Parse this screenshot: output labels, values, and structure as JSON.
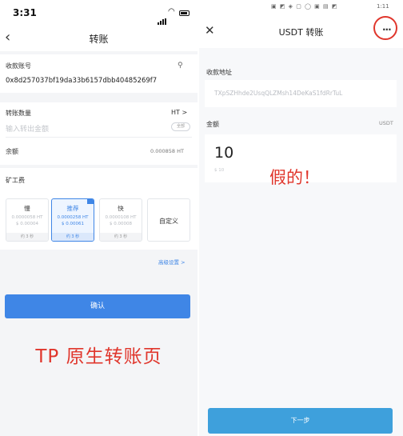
{
  "left": {
    "status": {
      "time": "3:31"
    },
    "nav": {
      "back_icon": "chevron-left-icon",
      "title": "转账"
    },
    "receiver": {
      "label": "收款账号",
      "address": "0x8d257037bf19da33b6157dbb40485269f7",
      "icon": "contact-add-icon"
    },
    "amount": {
      "label": "转账数量",
      "token": "HT >",
      "placeholder": "输入转出金额",
      "all_button": "全部"
    },
    "balance": {
      "label": "余额",
      "value": "0.000858 HT"
    },
    "fee": {
      "label": "矿工费",
      "options": [
        {
          "name": "慢",
          "line1": "0.0000058 HT",
          "line2": "$ 0.00004",
          "time": "约 3 秒",
          "selected": false
        },
        {
          "name": "推荐",
          "line1": "0.0000258 HT",
          "line2": "$ 0.00061",
          "time": "约 3 秒",
          "selected": true
        },
        {
          "name": "快",
          "line1": "0.0000108 HT",
          "line2": "$ 0.00008",
          "time": "约 3 秒",
          "selected": false
        },
        {
          "name": "自定义",
          "selected": false
        }
      ]
    },
    "advanced_link": "高级设置 >",
    "confirm_button": "确认",
    "caption": "TP 原生转账页"
  },
  "right": {
    "status": {
      "icons": "▣ ◩ ◈ ▢ ◯ ▣ ▤ ◩",
      "time": "1:11"
    },
    "nav": {
      "close_icon": "close-icon",
      "title": "USDT 转账",
      "more_icon": "more-icon",
      "more_glyph": "···"
    },
    "receiver": {
      "label": "收款地址",
      "address": "TXpSZHhde2UsqQLZMsh14DeKaS1fdRrTuL"
    },
    "amount": {
      "label": "金额",
      "unit": "USDT",
      "value": "10",
      "fiat": "$ 10"
    },
    "annotation": "假的！",
    "next_button": "下一步"
  },
  "colors": {
    "accent_blue": "#3f86e6",
    "annotation_red": "#e0362c",
    "next_button": "#3ea0dc"
  }
}
